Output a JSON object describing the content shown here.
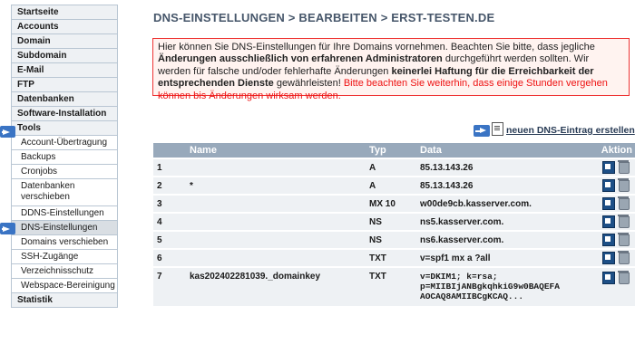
{
  "sidebar": {
    "items": [
      {
        "label": "Startseite"
      },
      {
        "label": "Accounts"
      },
      {
        "label": "Domain"
      },
      {
        "label": "Subdomain"
      },
      {
        "label": "E-Mail"
      },
      {
        "label": "FTP"
      },
      {
        "label": "Datenbanken"
      },
      {
        "label": "Software-Installation"
      },
      {
        "label": "Tools"
      },
      {
        "label": "Account-Übertragung"
      },
      {
        "label": "Backups"
      },
      {
        "label": "Cronjobs"
      },
      {
        "label": "Datenbanken verschieben"
      },
      {
        "label": "DDNS-Einstellungen"
      },
      {
        "label": "DNS-Einstellungen"
      },
      {
        "label": "Domains verschieben"
      },
      {
        "label": "SSH-Zugänge"
      },
      {
        "label": "Verzeichnisschutz"
      },
      {
        "label": "Webspace-Bereinigung"
      },
      {
        "label": "Statistik"
      }
    ]
  },
  "page": {
    "title": "DNS-EINSTELLUNGEN > BEARBEITEN > ERST-TESTEN.DE"
  },
  "notice": {
    "part1": "Hier können Sie DNS-Einstellungen für Ihre Domains vornehmen. Beachten Sie bitte, dass jegliche ",
    "part2_bold": "Änderungen ausschließlich von erfahrenen Administratoren",
    "part3": " durchgeführt werden sollten. Wir werden für falsche und/oder fehlerhafte Änderungen ",
    "part4_bold": "keinerlei Haftung für die Erreichbarkeit der entsprechenden Dienste",
    "part5": " gewährleisten! ",
    "part6_red": "Bitte beachten Sie weiterhin, dass einige Stunden vergehen können bis Änderungen wirksam werden."
  },
  "new_entry": {
    "label": "neuen DNS-Eintrag erstellen"
  },
  "table": {
    "headers": {
      "name": "Name",
      "typ": "Typ",
      "data": "Data",
      "aktion": "Aktion"
    },
    "rows": [
      {
        "num": "1",
        "name": "",
        "typ": "A",
        "data": "85.13.143.26"
      },
      {
        "num": "2",
        "name": "*",
        "typ": "A",
        "data": "85.13.143.26"
      },
      {
        "num": "3",
        "name": "",
        "typ": "MX 10",
        "data": "w00de9cb.kasserver.com."
      },
      {
        "num": "4",
        "name": "",
        "typ": "NS",
        "data": "ns5.kasserver.com."
      },
      {
        "num": "5",
        "name": "",
        "typ": "NS",
        "data": "ns6.kasserver.com."
      },
      {
        "num": "6",
        "name": "",
        "typ": "TXT",
        "data": "v=spf1 mx a ?all"
      },
      {
        "num": "7",
        "name": "kas202402281039._domainkey",
        "typ": "TXT",
        "data_lines": [
          "v=DKIM1; k=rsa;",
          "p=MIIBIjANBgkqhkiG9w0BAQEFA",
          "AOCAQ8AMIIBCgKCAQ..."
        ]
      }
    ]
  },
  "colors": {
    "header_bg": "#98a9bb",
    "row_bg": "#eef1f4",
    "title_color": "#46566a",
    "notice_border": "#e33",
    "notice_red": "#e11",
    "arrow_blue": "#3a74c4"
  },
  "icons": {
    "edit": "edit-icon",
    "delete": "trash-icon",
    "nav_arrow": "arrow-right-icon",
    "new_document": "new-document-icon"
  }
}
